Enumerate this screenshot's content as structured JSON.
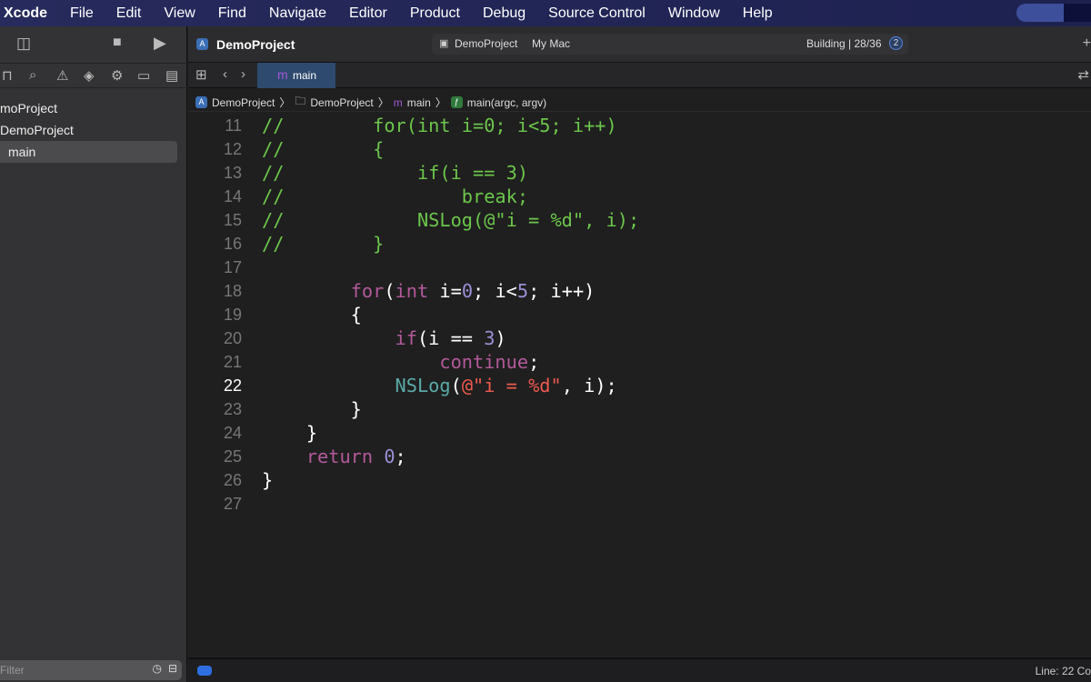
{
  "menubar": {
    "app": "Xcode",
    "items": [
      "File",
      "Edit",
      "View",
      "Find",
      "Navigate",
      "Editor",
      "Product",
      "Debug",
      "Source Control",
      "Window",
      "Help"
    ]
  },
  "toolbar": {
    "project": "DemoProject",
    "scheme": "DemoProject",
    "destination": "My Mac",
    "status": "Building | 28/36",
    "issue_count": "2"
  },
  "navigator": {
    "items": [
      {
        "label": "moProject"
      },
      {
        "label": "DemoProject"
      },
      {
        "label": "main"
      }
    ],
    "filter_placeholder": "Filter"
  },
  "tabs": [
    {
      "label": "main",
      "icon": "m"
    }
  ],
  "breadcrumb": [
    "DemoProject",
    "DemoProject",
    "main",
    "main(argc, argv)"
  ],
  "editor": {
    "current_line": 22,
    "lines": [
      {
        "n": "11",
        "t": [
          [
            "//        for(int i=0; i<5; i++)",
            "cm"
          ]
        ]
      },
      {
        "n": "12",
        "t": [
          [
            "//        {",
            "cm"
          ]
        ]
      },
      {
        "n": "13",
        "t": [
          [
            "//            if(i == 3)",
            "cm"
          ]
        ]
      },
      {
        "n": "14",
        "t": [
          [
            "//                break;",
            "cm"
          ]
        ]
      },
      {
        "n": "15",
        "t": [
          [
            "//            NSLog(@\"i = %d\", i);",
            "cm"
          ]
        ]
      },
      {
        "n": "16",
        "t": [
          [
            "//        }",
            "cm"
          ]
        ]
      },
      {
        "n": "17",
        "t": []
      },
      {
        "n": "18",
        "t": [
          [
            "        ",
            "pl"
          ],
          [
            "for",
            "kw"
          ],
          [
            "(",
            "pl"
          ],
          [
            "int",
            "kw"
          ],
          [
            " i=",
            "pl"
          ],
          [
            "0",
            "nm"
          ],
          [
            "; i<",
            "pl"
          ],
          [
            "5",
            "nm"
          ],
          [
            "; i++)",
            "pl"
          ]
        ]
      },
      {
        "n": "19",
        "t": [
          [
            "        {",
            "pl"
          ]
        ]
      },
      {
        "n": "20",
        "t": [
          [
            "            ",
            "pl"
          ],
          [
            "if",
            "kw"
          ],
          [
            "(i == ",
            "pl"
          ],
          [
            "3",
            "nm"
          ],
          [
            ")",
            "pl"
          ]
        ]
      },
      {
        "n": "21",
        "t": [
          [
            "                ",
            "pl"
          ],
          [
            "continue",
            "kw"
          ],
          [
            ";",
            "pl"
          ]
        ]
      },
      {
        "n": "22",
        "t": [
          [
            "            ",
            "pl"
          ],
          [
            "NSLog",
            "fn"
          ],
          [
            "(",
            "pl"
          ],
          [
            "@\"i = %d\"",
            "st"
          ],
          [
            ", i);",
            "pl"
          ]
        ]
      },
      {
        "n": "23",
        "t": [
          [
            "        }",
            "pl"
          ]
        ]
      },
      {
        "n": "24",
        "t": [
          [
            "    }",
            "pl"
          ]
        ]
      },
      {
        "n": "25",
        "t": [
          [
            "    ",
            "pl"
          ],
          [
            "return",
            "kw"
          ],
          [
            " ",
            "pl"
          ],
          [
            "0",
            "nm"
          ],
          [
            ";",
            "pl"
          ]
        ]
      },
      {
        "n": "26",
        "t": [
          [
            "}",
            "pl"
          ]
        ]
      },
      {
        "n": "27",
        "t": []
      }
    ]
  },
  "statusbar": {
    "position": "Line: 22  Co"
  }
}
